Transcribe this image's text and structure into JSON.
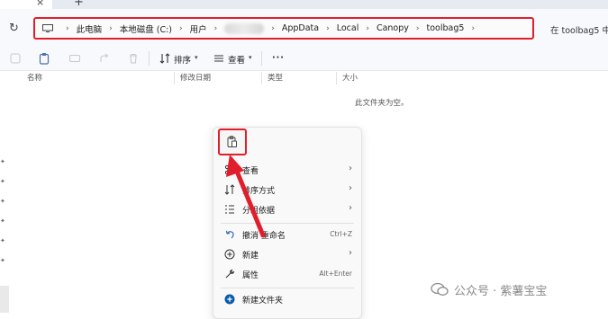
{
  "tabs": {
    "close_glyph": "×",
    "new_glyph": "+"
  },
  "nav": {
    "refresh_glyph": "↻"
  },
  "breadcrumb": [
    {
      "label": "此电脑"
    },
    {
      "label": "本地磁盘 (C:)"
    },
    {
      "label": "用户"
    },
    {
      "label": ""
    },
    {
      "label": "AppData"
    },
    {
      "label": "Local"
    },
    {
      "label": "Canopy"
    },
    {
      "label": "toolbag5"
    }
  ],
  "search": {
    "placeholder": "在 toolbag5 中"
  },
  "toolbar": {
    "sort_label": "排序",
    "view_label": "查看",
    "more_label": "···"
  },
  "columns": {
    "name": "名称",
    "modified": "修改日期",
    "type": "类型",
    "size": "大小"
  },
  "content": {
    "empty_message": "此文件夹为空。"
  },
  "context_menu": {
    "items": [
      {
        "label": "查看",
        "submenu": true
      },
      {
        "label": "排序方式",
        "submenu": true
      },
      {
        "label": "分组依据",
        "submenu": true
      },
      {
        "label": "撤消 重命名",
        "shortcut": "Ctrl+Z"
      },
      {
        "label": "新建",
        "submenu": true
      },
      {
        "label": "属性",
        "shortcut": "Alt+Enter"
      },
      {
        "label": "新建文件夹"
      }
    ]
  },
  "watermark": {
    "text": "公众号 · 紫薯宝宝"
  },
  "colors": {
    "highlight_red": "#e11e2b",
    "accent_blue": "#0b5cad"
  }
}
